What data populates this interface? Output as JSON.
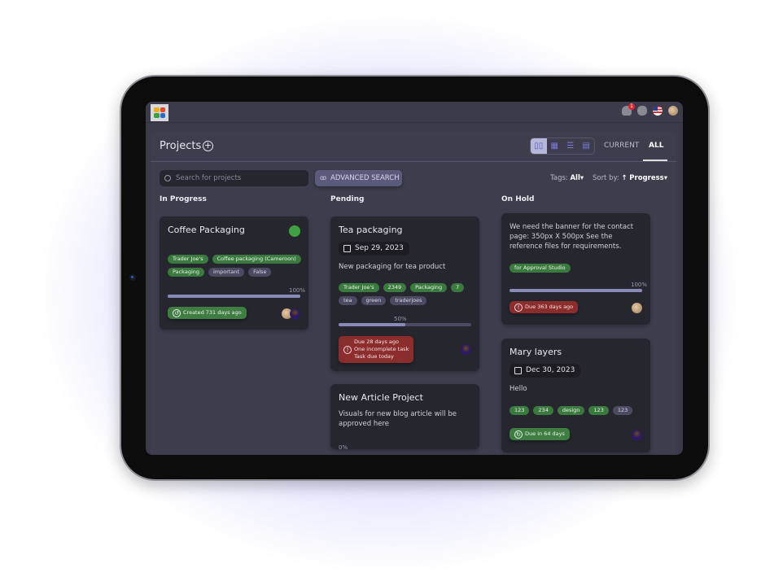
{
  "topbar": {
    "notification_count": "1",
    "icons": [
      "app-logo",
      "bell-icon",
      "database-icon",
      "us-flag-icon",
      "user-avatar"
    ]
  },
  "header": {
    "title": "Projects",
    "add_icon": "+",
    "view_modes": [
      "kanban",
      "grid",
      "list",
      "board"
    ],
    "active_view": "kanban",
    "tabs": [
      {
        "label": "CURRENT",
        "active": false
      },
      {
        "label": "ALL",
        "active": true
      }
    ]
  },
  "toolbar": {
    "search_placeholder": "Search for projects",
    "advanced_search_label": "ADVANCED SEARCH",
    "tags_label": "Tags:",
    "tags_value": "All",
    "sort_label": "Sort by:",
    "sort_arrow": "↑",
    "sort_value": "Progress"
  },
  "columns": [
    {
      "title": "In Progress",
      "cards": [
        {
          "title": "Coffee Packaging",
          "tags": [
            {
              "label": "Trader Joe's",
              "color": "green"
            },
            {
              "label": "Coffee packaging (Cameroon)",
              "color": "green"
            },
            {
              "label": "Packaging",
              "color": "green"
            },
            {
              "label": "important",
              "color": "gray"
            },
            {
              "label": "False",
              "color": "gray"
            }
          ],
          "progress_label": "100%",
          "progress": 1.0,
          "status": "Created 731 days ago",
          "status_color": "green"
        }
      ]
    },
    {
      "title": "Pending",
      "cards": [
        {
          "title": "Tea packaging",
          "date": "Sep 29, 2023",
          "description": "New packaging for tea product",
          "tags": [
            {
              "label": "Trader Joe's",
              "color": "green"
            },
            {
              "label": "2349",
              "color": "green"
            },
            {
              "label": "Packaging",
              "color": "green"
            },
            {
              "label": "7",
              "color": "green"
            },
            {
              "label": "tea",
              "color": "gray"
            },
            {
              "label": "green",
              "color": "gray"
            },
            {
              "label": "traderjoes",
              "color": "gray"
            }
          ],
          "progress_label": "50%",
          "progress": 0.5,
          "status_lines": [
            "Due 28 days ago",
            "One incomplete task",
            "Task due today"
          ],
          "status_color": "red"
        },
        {
          "title": "New Article Project",
          "description": "Visuals for new blog article will be approved here",
          "progress_label": "0%"
        }
      ]
    },
    {
      "title": "On Hold",
      "cards": [
        {
          "description": "We need the banner for the contact page: 350px X 500px See the reference files for requirements.",
          "tags": [
            {
              "label": "for Approval Studio",
              "color": "green"
            }
          ],
          "progress_label": "100%",
          "progress": 1.0,
          "status": "Due 363 days ago",
          "status_color": "red"
        },
        {
          "title": "Mary layers",
          "date": "Dec 30, 2023",
          "description": "Hello",
          "tags": [
            {
              "label": "123",
              "color": "green"
            },
            {
              "label": "234",
              "color": "green"
            },
            {
              "label": "design",
              "color": "green"
            },
            {
              "label": "123",
              "color": "green"
            },
            {
              "label": "123",
              "color": "gray"
            }
          ],
          "status": "Due in 64 days",
          "status_color": "green"
        }
      ]
    }
  ],
  "colors": {
    "accent": "#7b7bdc",
    "tag_green": "#3a7a3e",
    "tag_gray": "#4a4a62",
    "status_red": "#8b2d2d",
    "status_green": "#3f7d42"
  }
}
